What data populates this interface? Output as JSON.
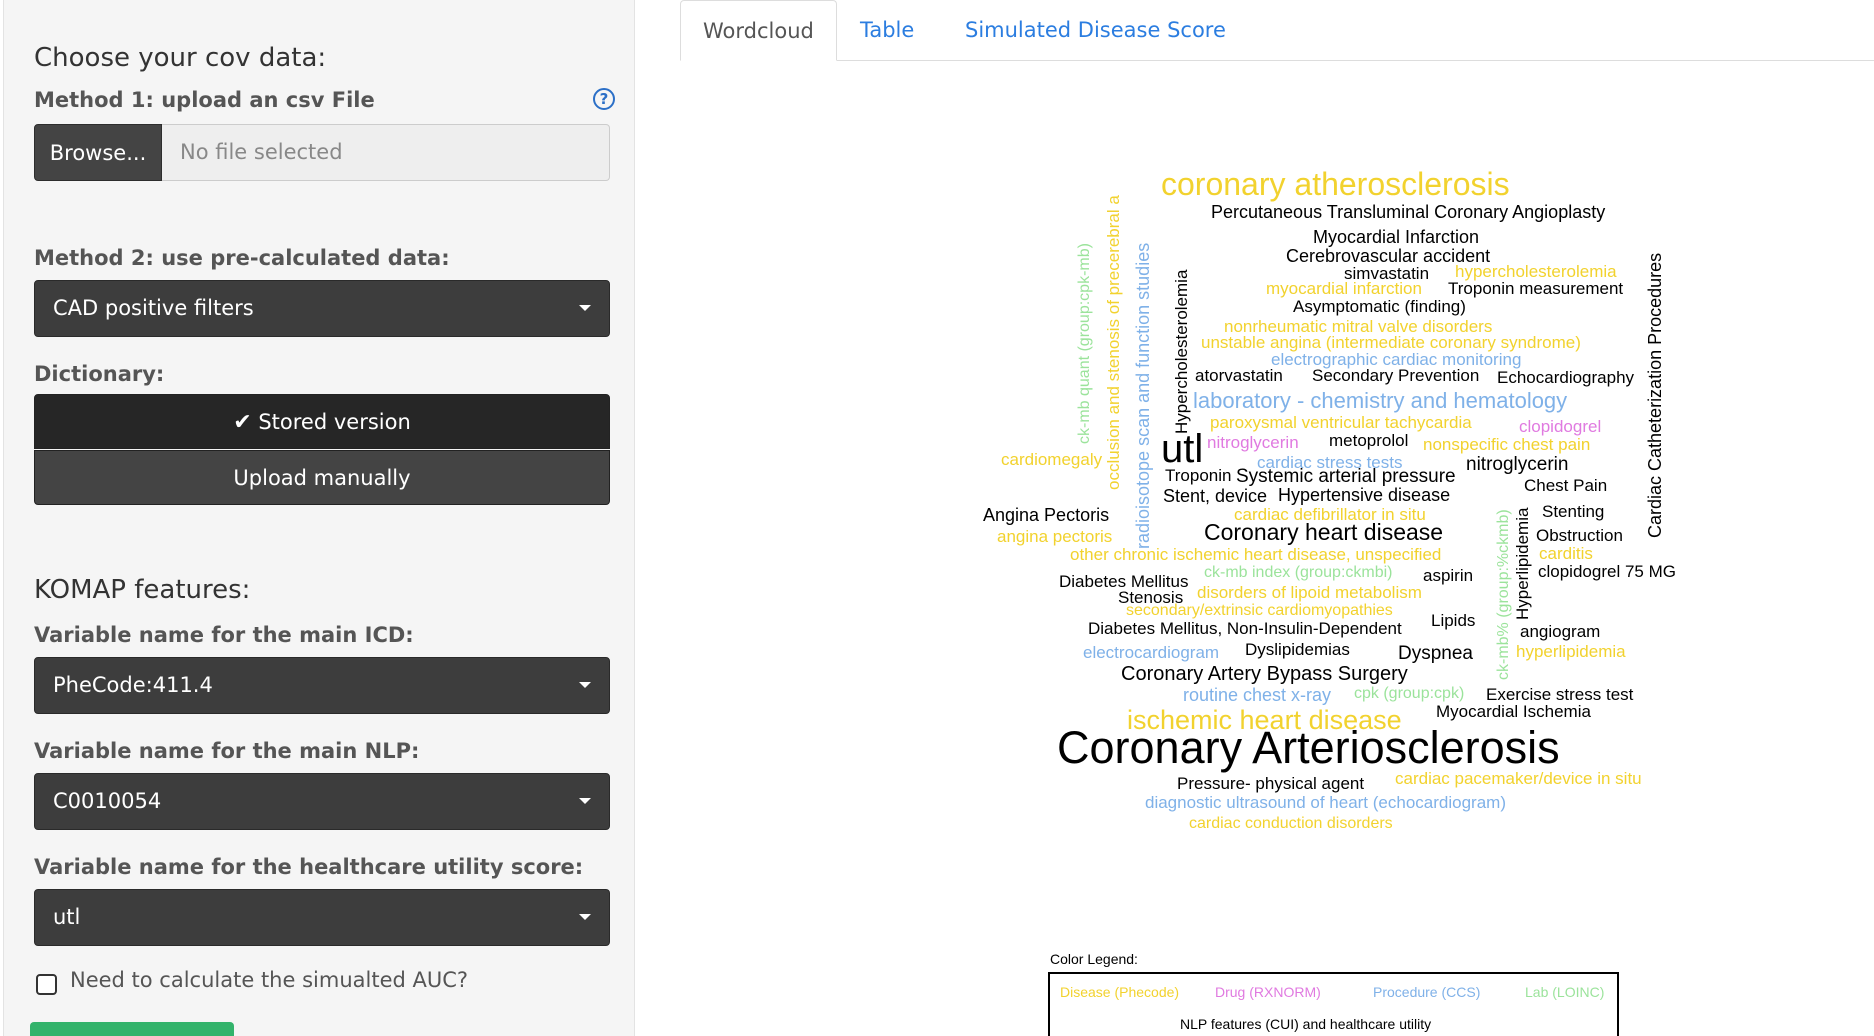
{
  "sidebar": {
    "cov_title": "Choose your cov data:",
    "method1_label": "Method 1: upload an csv File",
    "help_icon": "?",
    "browse_label": "Browse...",
    "file_placeholder": "No file selected",
    "method2_label": "Method 2: use pre-calculated data:",
    "method2_value": "CAD positive filters",
    "dictionary_label": "Dictionary:",
    "dict_stored": "Stored version",
    "dict_upload": "Upload manually",
    "komap_title": "KOMAP features:",
    "main_icd_label": "Variable name for the main ICD:",
    "main_icd_value": "PheCode:411.4",
    "main_nlp_label": "Variable name for the main NLP:",
    "main_nlp_value": "C0010054",
    "util_label": "Variable name for the healthcare utility score:",
    "util_value": "utl",
    "auc_label": "Need to calculate the simualted AUC?"
  },
  "tabs": [
    "Wordcloud",
    "Table",
    "Simulated Disease Score"
  ],
  "colors": {
    "disease": "#f2d22e",
    "drug": "#e07ae0",
    "procedure": "#7fb1e8",
    "lab": "#9be39b",
    "nlp": "#000000",
    "accent": "#2b7de0"
  },
  "wordcloud": {
    "words": [
      {
        "text": "coronary atherosclerosis",
        "cat": "disease"
      },
      {
        "text": "Percutaneous Transluminal Coronary Angioplasty",
        "cat": "nlp"
      },
      {
        "text": "Myocardial Infarction",
        "cat": "nlp"
      },
      {
        "text": "Cerebrovascular accident",
        "cat": "nlp"
      },
      {
        "text": "simvastatin",
        "cat": "nlp"
      },
      {
        "text": "hypercholesterolemia",
        "cat": "disease"
      },
      {
        "text": "myocardial infarction",
        "cat": "disease"
      },
      {
        "text": "Troponin measurement",
        "cat": "nlp"
      },
      {
        "text": "Asymptomatic (finding)",
        "cat": "nlp"
      },
      {
        "text": "nonrheumatic mitral valve disorders",
        "cat": "disease"
      },
      {
        "text": "unstable angina (intermediate coronary syndrome)",
        "cat": "disease"
      },
      {
        "text": "electrographic cardiac monitoring",
        "cat": "procedure"
      },
      {
        "text": "atorvastatin",
        "cat": "nlp"
      },
      {
        "text": "Secondary Prevention",
        "cat": "nlp"
      },
      {
        "text": "Echocardiography",
        "cat": "nlp"
      },
      {
        "text": "laboratory - chemistry and hematology",
        "cat": "procedure"
      },
      {
        "text": "paroxysmal ventricular tachycardia",
        "cat": "disease"
      },
      {
        "text": "clopidogrel",
        "cat": "drug"
      },
      {
        "text": "utl",
        "cat": "nlp"
      },
      {
        "text": "nitroglycerin",
        "cat": "drug"
      },
      {
        "text": "metoprolol",
        "cat": "nlp"
      },
      {
        "text": "nonspecific chest pain",
        "cat": "disease"
      },
      {
        "text": "cardiomegaly",
        "cat": "disease"
      },
      {
        "text": "cardiac stress tests",
        "cat": "procedure"
      },
      {
        "text": "nitroglycerin",
        "cat": "nlp"
      },
      {
        "text": "Troponin",
        "cat": "nlp"
      },
      {
        "text": "Systemic arterial pressure",
        "cat": "nlp"
      },
      {
        "text": "Chest Pain",
        "cat": "nlp"
      },
      {
        "text": "Stent, device",
        "cat": "nlp"
      },
      {
        "text": "Hypertensive disease",
        "cat": "nlp"
      },
      {
        "text": "Stenting",
        "cat": "nlp"
      },
      {
        "text": "Angina Pectoris",
        "cat": "nlp"
      },
      {
        "text": "cardiac defibrillator in situ",
        "cat": "disease"
      },
      {
        "text": "Obstruction",
        "cat": "nlp"
      },
      {
        "text": "angina pectoris",
        "cat": "disease"
      },
      {
        "text": "Coronary heart disease",
        "cat": "nlp"
      },
      {
        "text": "carditis",
        "cat": "disease"
      },
      {
        "text": "other chronic ischemic heart disease, unspecified",
        "cat": "disease"
      },
      {
        "text": "clopidogrel 75 MG",
        "cat": "nlp"
      },
      {
        "text": "Diabetes Mellitus",
        "cat": "nlp"
      },
      {
        "text": "ck-mb index (group:ckmbi)",
        "cat": "lab"
      },
      {
        "text": "aspirin",
        "cat": "nlp"
      },
      {
        "text": "Stenosis",
        "cat": "nlp"
      },
      {
        "text": "disorders of lipoid metabolism",
        "cat": "disease"
      },
      {
        "text": "secondary/extrinsic cardiomyopathies",
        "cat": "disease"
      },
      {
        "text": "Lipids",
        "cat": "nlp"
      },
      {
        "text": "Diabetes Mellitus, Non-Insulin-Dependent",
        "cat": "nlp"
      },
      {
        "text": "angiogram",
        "cat": "nlp"
      },
      {
        "text": "electrocardiogram",
        "cat": "procedure"
      },
      {
        "text": "Dyslipidemias",
        "cat": "nlp"
      },
      {
        "text": "Dyspnea",
        "cat": "nlp"
      },
      {
        "text": "hyperlipidemia",
        "cat": "disease"
      },
      {
        "text": "Coronary Artery Bypass Surgery",
        "cat": "nlp"
      },
      {
        "text": "routine chest x-ray",
        "cat": "procedure"
      },
      {
        "text": "cpk (group:cpk)",
        "cat": "lab"
      },
      {
        "text": "Exercise stress test",
        "cat": "nlp"
      },
      {
        "text": "ischemic heart disease",
        "cat": "disease"
      },
      {
        "text": "Myocardial Ischemia",
        "cat": "nlp"
      },
      {
        "text": "Coronary Arteriosclerosis",
        "cat": "nlp"
      },
      {
        "text": "Pressure- physical agent",
        "cat": "nlp"
      },
      {
        "text": "cardiac pacemaker/device in situ",
        "cat": "disease"
      },
      {
        "text": "diagnostic ultrasound of heart (echocardiogram)",
        "cat": "procedure"
      },
      {
        "text": "cardiac conduction disorders",
        "cat": "disease"
      },
      {
        "text": "ck-mb quant (group:cpk-mb)",
        "cat": "lab"
      },
      {
        "text": "occlusion and stenosis of precerebral a",
        "cat": "disease"
      },
      {
        "text": "radioisotope scan and function studies",
        "cat": "procedure"
      },
      {
        "text": "Hypercholesterolemia",
        "cat": "nlp"
      },
      {
        "text": "ck-mb% (group:%ckmb)",
        "cat": "lab"
      },
      {
        "text": "Hyperlipidemia",
        "cat": "nlp"
      },
      {
        "text": "Cardiac Catheterization Procedures",
        "cat": "nlp"
      }
    ]
  },
  "legend": {
    "title": "Color Legend:",
    "disease": "Disease (Phecode)",
    "drug": "Drug (RXNORM)",
    "procedure": "Procedure (CCS)",
    "lab": "Lab (LOINC)",
    "nlp": "NLP features (CUI) and healthcare utility"
  }
}
